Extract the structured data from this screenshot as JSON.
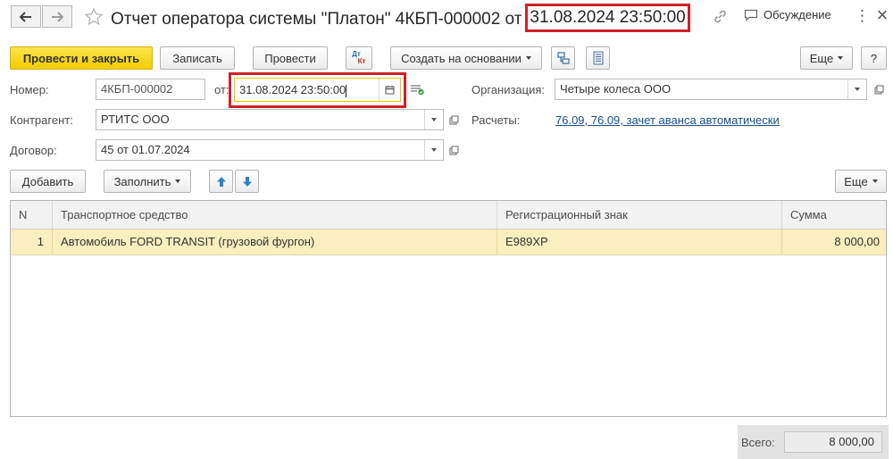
{
  "window": {
    "title": "Отчет оператора системы \"Платон\" 4КБП-000002 от",
    "title_date": "31.08.2024 23:50:00",
    "discussion_label": "Обсуждение",
    "more_icon": "⋮",
    "close_icon": "×"
  },
  "toolbar": {
    "post_close": "Провести и закрыть",
    "save": "Записать",
    "post": "Провести",
    "dt_kt_top": "Дт",
    "dt_kt_bottom": "Кт",
    "create_based": "Создать на основании",
    "more": "Еще",
    "help": "?"
  },
  "form": {
    "number_label": "Номер:",
    "number_value": "4КБП-000002",
    "from_label": "от:",
    "date_value": "31.08.2024 23:50:00",
    "org_label": "Организация:",
    "org_value": "Четыре колеса ООО",
    "counterparty_label": "Контрагент:",
    "counterparty_value": "РТИТС ООО",
    "settlements_label": "Расчеты:",
    "settlements_value": "76.09, 76.09, зачет аванса автоматически",
    "contract_label": "Договор:",
    "contract_value": "45 от 01.07.2024"
  },
  "table_toolbar": {
    "add": "Добавить",
    "fill": "Заполнить",
    "more": "Еще"
  },
  "table": {
    "columns": [
      "N",
      "Транспортное средство",
      "Регистрационный знак",
      "Сумма"
    ],
    "rows": [
      {
        "n": "1",
        "vehicle": "Автомобиль FORD TRANSIT (грузовой фургон)",
        "plate": "Е989ХР",
        "sum": "8 000,00"
      }
    ]
  },
  "footer": {
    "total_label": "Всего:",
    "total_value": "8 000,00"
  },
  "colors": {
    "accent_yellow": "#f2cd00",
    "highlight_red": "#d0202a",
    "selected_row": "#fbeebf",
    "link": "#1c4e87"
  }
}
